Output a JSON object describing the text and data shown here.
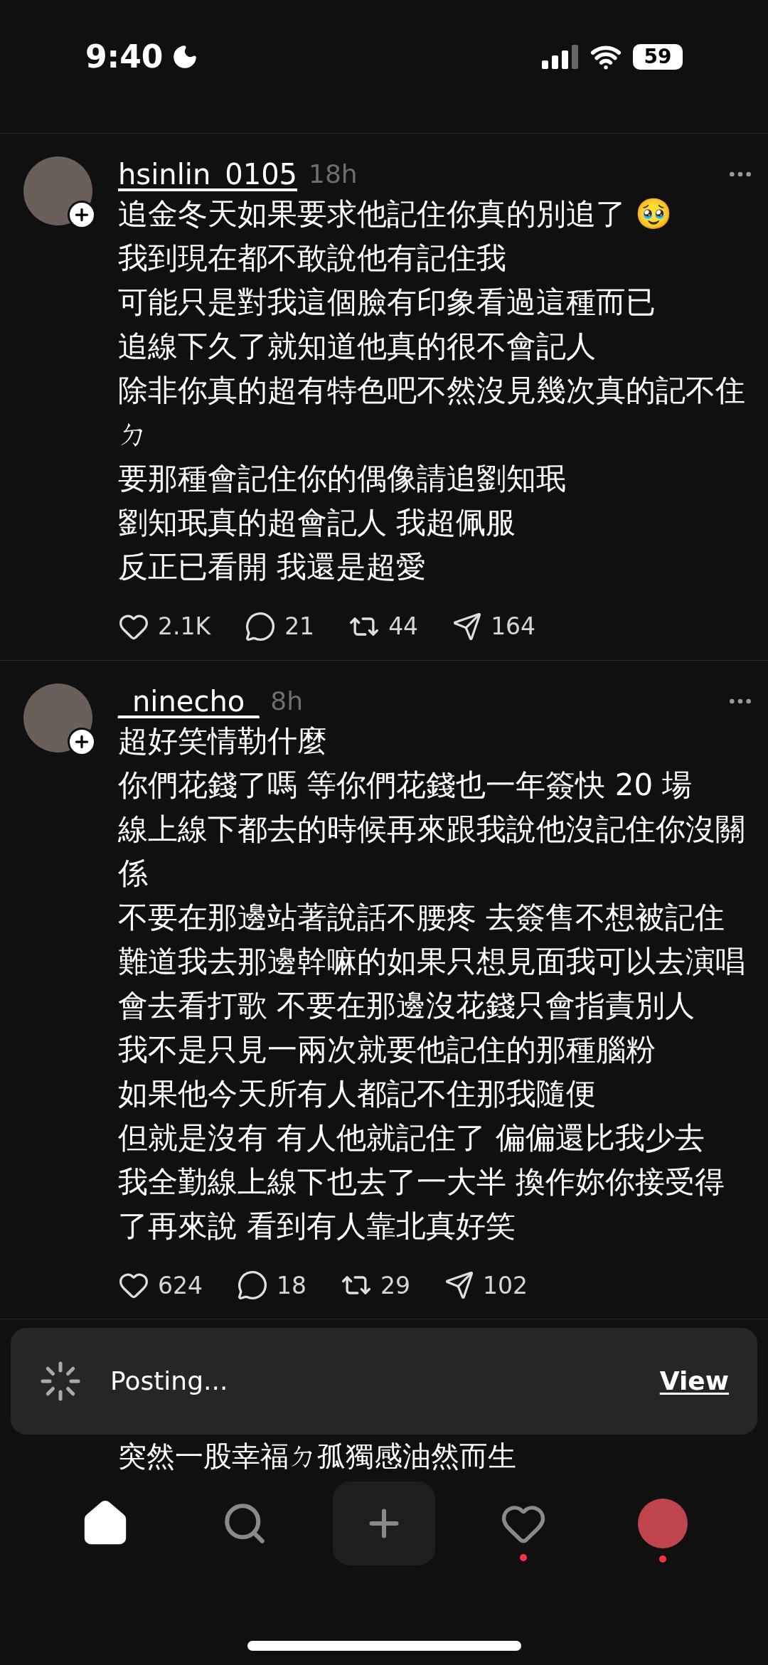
{
  "status_bar": {
    "time": "9:40",
    "battery": "59"
  },
  "posts": [
    {
      "username": "hsinlin_0105",
      "time": "18h",
      "emoji": "🥹",
      "lines": [
        "追金冬天如果要求他記住你真的別追了",
        "我到現在都不敢說他有記住我",
        "可能只是對我這個臉有印象看過這種而已",
        "追線下久了就知道他真的很不會記人",
        "除非你真的超有特色吧不然沒見幾次真的記不住ㄉ",
        "要那種會記住你的偶像請追劉知珉",
        "劉知珉真的超會記人 我超佩服",
        "反正已看開 我還是超愛"
      ],
      "likes": "2.1K",
      "replies": "21",
      "reposts": "44",
      "shares": "164"
    },
    {
      "username": "_ninecho_",
      "time": "8h",
      "lines": [
        "超好笑情勒什麼",
        "你們花錢了嗎 等你們花錢也一年簽快 20 場",
        "線上線下都去的時候再來跟我說他沒記住你沒關係",
        "不要在那邊站著說話不腰疼 去簽售不想被記住",
        "難道我去那邊幹嘛的如果只想見面我可以去演唱會去看打歌 不要在那邊沒花錢只會指責別人",
        "我不是只見一兩次就要他記住的那種腦粉",
        "如果他今天所有人都記不住那我隨便",
        "但就是沒有 有人他就記住了 偏偏還比我少去",
        "我全勤線上線下也去了一大半 換作妳你接受得了再來說 看到有人靠北真好笑"
      ],
      "likes": "624",
      "replies": "18",
      "reposts": "29",
      "shares": "102"
    }
  ],
  "partial_line": "突然一股幸福ㄉ孤獨感油然而生",
  "toast": {
    "text": "Posting...",
    "action": "View"
  },
  "nav": [
    {
      "kind": "home",
      "selected": true,
      "dot": false
    },
    {
      "kind": "search",
      "selected": false,
      "dot": false
    },
    {
      "kind": "create",
      "selected": false,
      "dot": false
    },
    {
      "kind": "activity",
      "selected": false,
      "dot": true
    },
    {
      "kind": "profile",
      "selected": false,
      "dot": true
    }
  ]
}
